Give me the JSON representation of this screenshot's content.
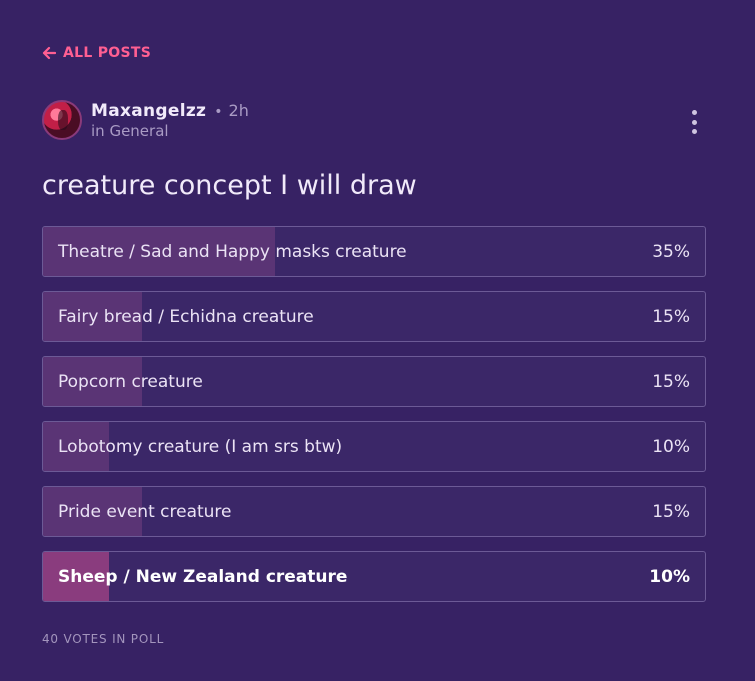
{
  "nav": {
    "back_label": "ALL POSTS"
  },
  "post": {
    "author": "Maxangelzz",
    "time": "2h",
    "community": "in General",
    "title": "creature concept I will draw",
    "separator": "•"
  },
  "poll": {
    "options": [
      {
        "label": "Theatre / Sad and Happy masks creature",
        "percent_text": "35%",
        "percent": 35,
        "selected": false
      },
      {
        "label": "Fairy bread / Echidna creature",
        "percent_text": "15%",
        "percent": 15,
        "selected": false
      },
      {
        "label": "Popcorn creature",
        "percent_text": "15%",
        "percent": 15,
        "selected": false
      },
      {
        "label": "Lobotomy creature (I am srs btw)",
        "percent_text": "10%",
        "percent": 10,
        "selected": false
      },
      {
        "label": "Pride event creature",
        "percent_text": "15%",
        "percent": 15,
        "selected": false
      },
      {
        "label": "Sheep / New Zealand creature",
        "percent_text": "10%",
        "percent": 10,
        "selected": true
      }
    ],
    "votes_text": "40 VOTES IN POLL"
  },
  "colors": {
    "background": "#372264",
    "accent": "#ff5f92",
    "bar_fill": "#5a3475",
    "bar_fill_selected": "#8a3c7e"
  },
  "icons": {
    "back": "arrow-left-icon",
    "menu": "more-vertical-icon"
  }
}
